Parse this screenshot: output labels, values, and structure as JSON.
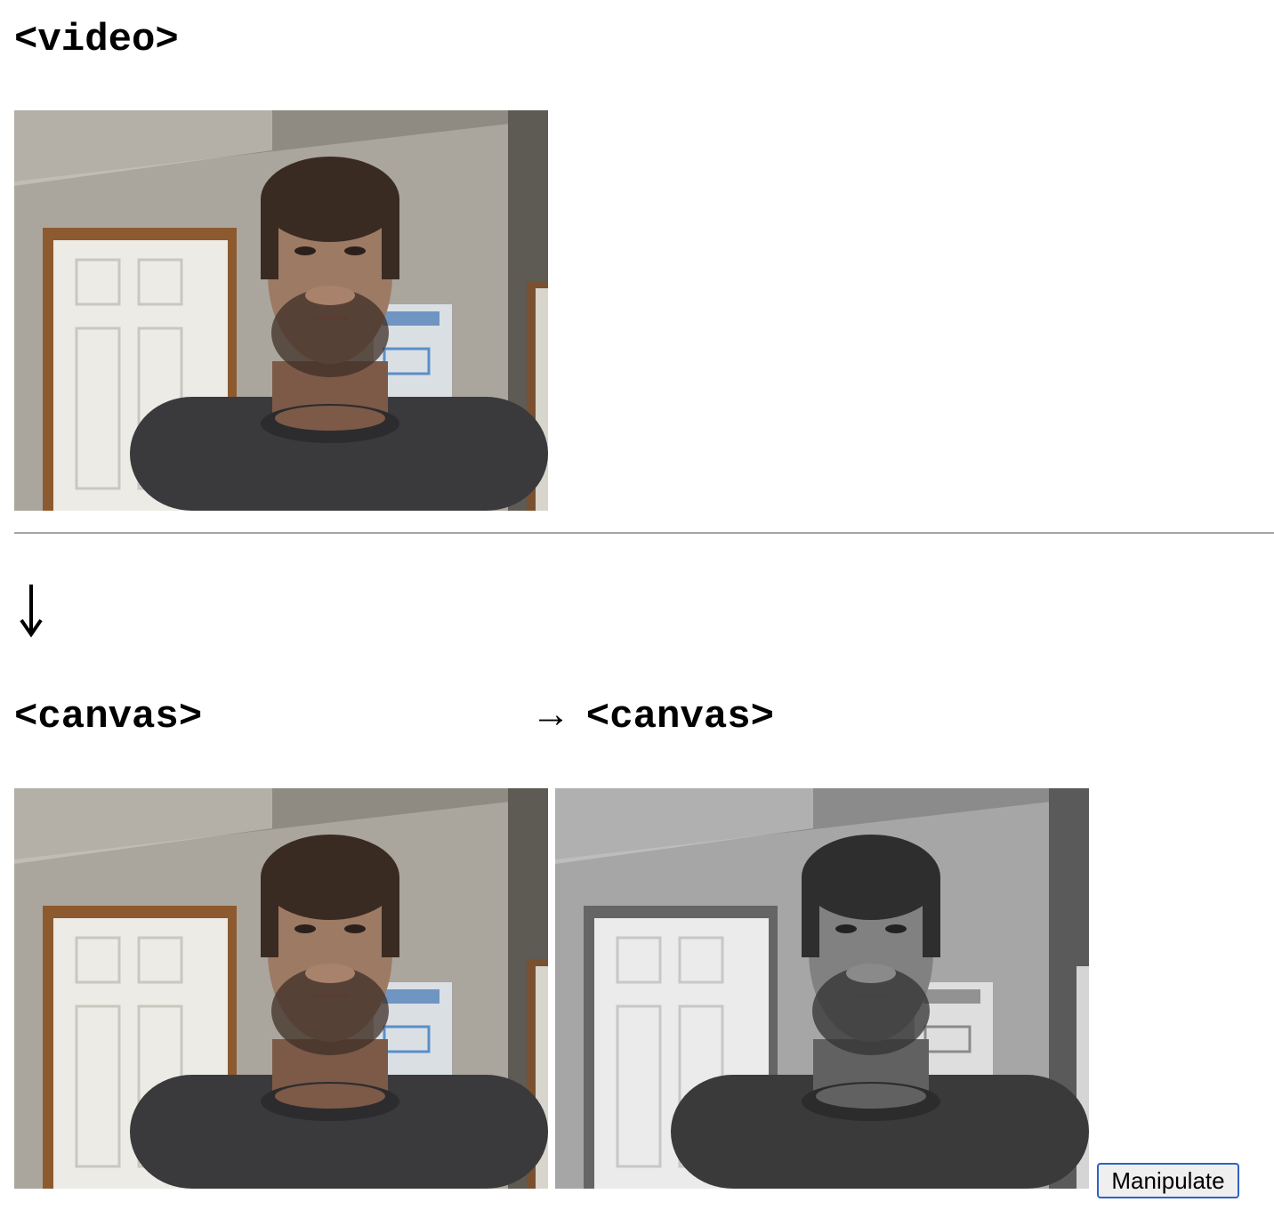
{
  "headings": {
    "video": "<video>",
    "canvas_source": "<canvas>",
    "canvas_output": "→ <canvas>"
  },
  "button": {
    "label": "Manipulate"
  },
  "icons": {
    "down_arrow": "down-arrow-icon"
  },
  "colors": {
    "divider": "#a6a6a6",
    "button_border": "#2f62c6",
    "button_background": "#efefef"
  }
}
